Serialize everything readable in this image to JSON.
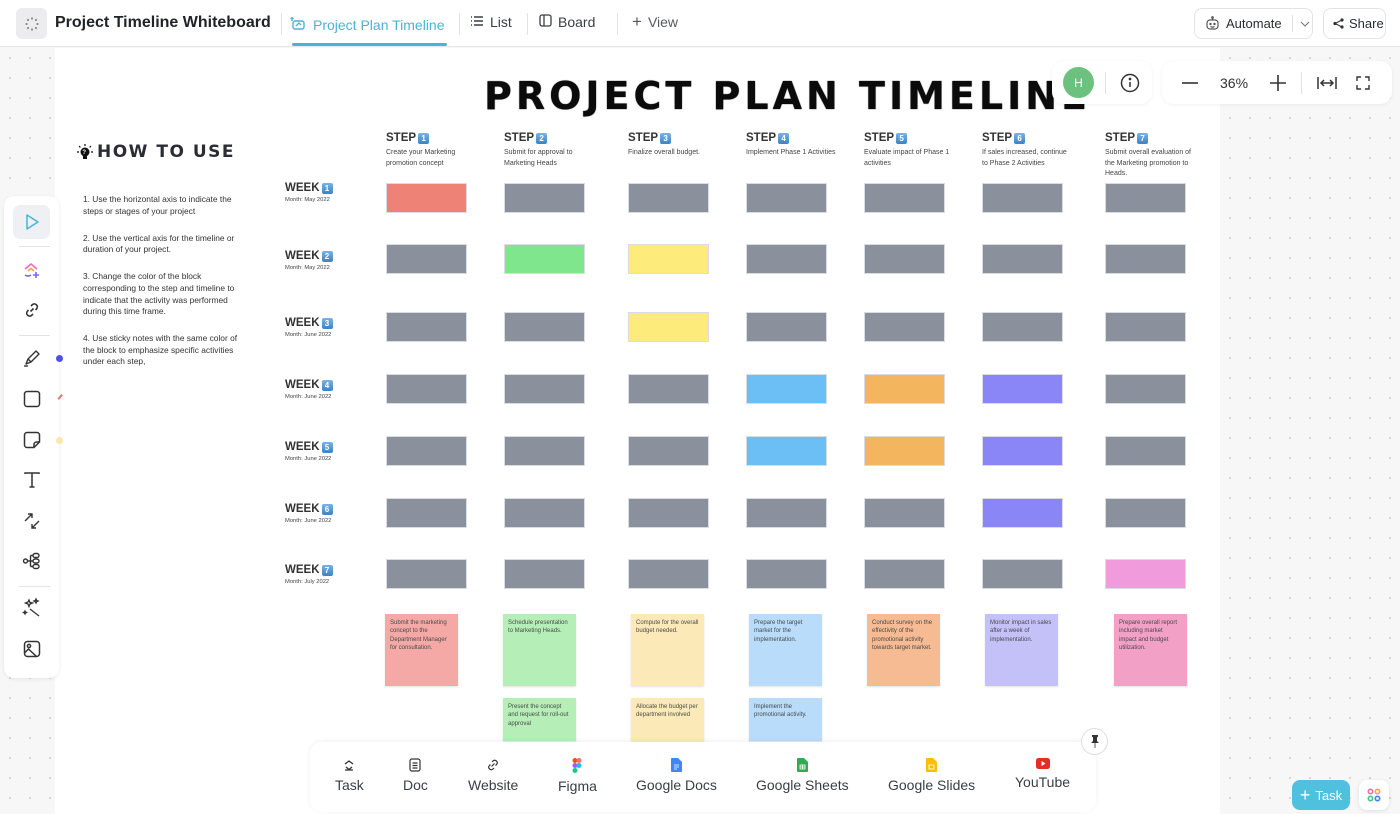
{
  "header": {
    "workspace_title": "Project Timeline Whiteboard",
    "tabs": [
      {
        "label": "Project Plan Timeline",
        "icon": "whiteboard-icon",
        "active": true
      },
      {
        "label": "List",
        "icon": "list-icon",
        "active": false
      },
      {
        "label": "Board",
        "icon": "board-icon",
        "active": false
      }
    ],
    "add_view_label": "View",
    "automate_label": "Automate",
    "share_label": "Share"
  },
  "canvas_controls": {
    "avatar_initial": "H",
    "avatar_color": "#6cc17e",
    "zoom_level": "36%"
  },
  "whiteboard": {
    "title": "PROJECT PLAN TIMELINE",
    "how_to": {
      "heading": "HOW TO USE",
      "items": [
        "1. Use the horizontal axis to indicate the steps or stages of your project",
        "2. Use the vertical axis for the timeline or duration of your project.",
        "3. Change the color of the block corresponding to the step and timeline to indicate that the activity was performed during this time frame.",
        "4. Use sticky notes with the same color of the block to emphasize specific activities under each step,"
      ]
    },
    "step_label": "STEP",
    "steps": [
      {
        "num": "1",
        "desc": "Create your Marketing promotion concept"
      },
      {
        "num": "2",
        "desc": "Submit for approval to Marketing Heads"
      },
      {
        "num": "3",
        "desc": "Finalize overall budget."
      },
      {
        "num": "4",
        "desc": "Implement Phase 1 Activities"
      },
      {
        "num": "5",
        "desc": "Evaluate impact of Phase 1 activities"
      },
      {
        "num": "6",
        "desc": "If sales increased, continue to Phase 2 Activities"
      },
      {
        "num": "7",
        "desc": "Submit overall evaluation of the Marketing promotion to Heads."
      }
    ],
    "week_label": "WEEK",
    "weeks": [
      {
        "num": "1",
        "month": "Month: May 2022"
      },
      {
        "num": "2",
        "month": "Month: May 2022"
      },
      {
        "num": "3",
        "month": "Month: June 2022"
      },
      {
        "num": "4",
        "month": "Month: June 2022"
      },
      {
        "num": "5",
        "month": "Month: June 2022"
      },
      {
        "num": "6",
        "month": "Month: June 2022"
      },
      {
        "num": "7",
        "month": "Month: July 2022"
      }
    ],
    "colors": {
      "empty": "#8a909c",
      "red": "#ef8276",
      "green": "#80e68e",
      "yellow": "#fdec7c",
      "blue": "#6bbff5",
      "orange": "#f4b55f",
      "purple": "#8b86f8",
      "pink": "#f09bdb"
    },
    "grid": [
      [
        "red",
        "empty",
        "empty",
        "empty",
        "empty",
        "empty",
        "empty"
      ],
      [
        "empty",
        "green",
        "yellow",
        "empty",
        "empty",
        "empty",
        "empty"
      ],
      [
        "empty",
        "empty",
        "yellow",
        "empty",
        "empty",
        "empty",
        "empty"
      ],
      [
        "empty",
        "empty",
        "empty",
        "blue",
        "orange",
        "purple",
        "empty"
      ],
      [
        "empty",
        "empty",
        "empty",
        "blue",
        "orange",
        "purple",
        "empty"
      ],
      [
        "empty",
        "empty",
        "empty",
        "empty",
        "empty",
        "purple",
        "empty"
      ],
      [
        "empty",
        "empty",
        "empty",
        "empty",
        "empty",
        "empty",
        "pink"
      ]
    ],
    "sticky_notes": [
      {
        "step": 1,
        "row": 0,
        "color": "#f4a9a6",
        "text": "Submit the marketing concept to the Department Manager for consultation."
      },
      {
        "step": 2,
        "row": 0,
        "color": "#b5efb7",
        "text": "Schedule presentation to Marketing Heads."
      },
      {
        "step": 2,
        "row": 1,
        "color": "#b5efb7",
        "text": "Present the concept and request for roll-out approval"
      },
      {
        "step": 3,
        "row": 0,
        "color": "#fbeab8",
        "text": "Compute for the overall budget needed."
      },
      {
        "step": 3,
        "row": 1,
        "color": "#fbeab8",
        "text": "Allocate the budget per department involved"
      },
      {
        "step": 4,
        "row": 0,
        "color": "#b8dcfa",
        "text": "Prepare the target market for the implementation."
      },
      {
        "step": 4,
        "row": 1,
        "color": "#b8dcfa",
        "text": "Implement the promotional activity."
      },
      {
        "step": 5,
        "row": 0,
        "color": "#f6bb92",
        "text": "Conduct survey on the effectivity of the promotional activity towards target market."
      },
      {
        "step": 6,
        "row": 0,
        "color": "#c4c0f8",
        "text": "Monitor impact in sales after a week of implementation."
      },
      {
        "step": 7,
        "row": 0,
        "color": "#f2a0c6",
        "text": "Prepare overall report including market impact and budget utilization."
      }
    ]
  },
  "left_toolbar": [
    {
      "name": "select-tool",
      "icon": "cursor-icon",
      "active": true
    },
    {
      "name": "clickup-tool",
      "icon": "clickup-add-icon"
    },
    {
      "name": "link-tool",
      "icon": "link-icon"
    },
    {
      "name": "pen-tool",
      "icon": "pen-icon"
    },
    {
      "name": "shape-tool",
      "icon": "square-icon"
    },
    {
      "name": "sticky-tool",
      "icon": "sticky-note-icon"
    },
    {
      "name": "text-tool",
      "icon": "text-icon"
    },
    {
      "name": "connector-tool",
      "icon": "arrows-icon"
    },
    {
      "name": "mindmap-tool",
      "icon": "mindmap-icon"
    },
    {
      "name": "ai-tool",
      "icon": "magic-wand-icon"
    },
    {
      "name": "image-tool",
      "icon": "image-icon"
    }
  ],
  "bottom_bar": [
    {
      "label": "Task",
      "icon": "task-icon"
    },
    {
      "label": "Doc",
      "icon": "doc-icon"
    },
    {
      "label": "Website",
      "icon": "link-icon"
    },
    {
      "label": "Figma",
      "icon": "figma-icon"
    },
    {
      "label": "Google Docs",
      "icon": "google-docs-icon"
    },
    {
      "label": "Google Sheets",
      "icon": "google-sheets-icon"
    },
    {
      "label": "Google Slides",
      "icon": "google-slides-icon"
    },
    {
      "label": "YouTube",
      "icon": "youtube-icon"
    }
  ],
  "fab": {
    "task_label": "Task"
  }
}
